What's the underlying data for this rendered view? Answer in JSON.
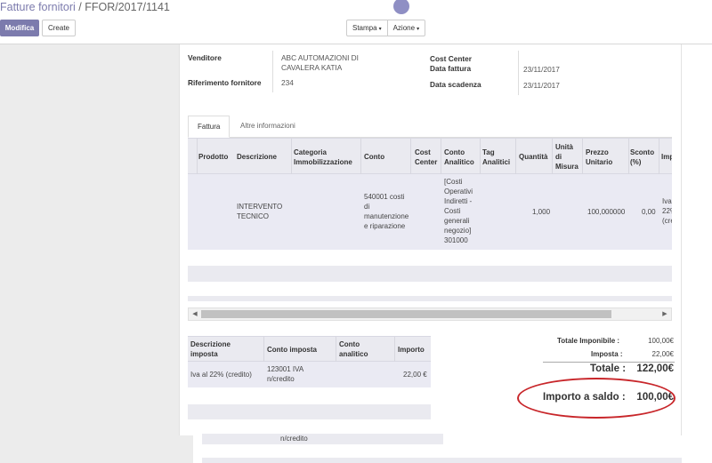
{
  "breadcrumb": {
    "parent": "Fatture fornitori",
    "separator": "/",
    "current": "FFOR/2017/1141"
  },
  "buttons": {
    "edit": "Modifica",
    "create": "Create",
    "print": "Stampa",
    "action": "Azione",
    "caret": "▾"
  },
  "header_fields": {
    "vendor_label": "Venditore",
    "vendor_value_line1": "ABC AUTOMAZIONI DI",
    "vendor_value_line2": "CAVALERA KATIA",
    "reference_label": "Riferimento fornitore",
    "reference_value": "234",
    "cost_center_label": "Cost Center",
    "invoice_date_label": "Data fattura",
    "invoice_date_value": "23/11/2017",
    "due_date_label": "Data scadenza",
    "due_date_value": "23/11/2017"
  },
  "tabs": [
    "Fattura",
    "Altre informazioni"
  ],
  "lines_table": {
    "headers": {
      "product": "Prodotto",
      "description": "Descrizione",
      "category_l1": "Categoria",
      "category_l2": "Immobilizzazione",
      "account": "Conto",
      "cost_center_l1": "Cost",
      "cost_center_l2": "Center",
      "analytic_l1": "Conto",
      "analytic_l2": "Analitico",
      "tags_l1": "Tag",
      "tags_l2": "Analitici",
      "quantity": "Quantità",
      "uom_l1": "Unità",
      "uom_l2": "di",
      "uom_l3": "Misura",
      "price_l1": "Prezzo",
      "price_l2": "Unitario",
      "discount_l1": "Sconto",
      "discount_l2": "(%)",
      "taxes": "Imp"
    },
    "row": {
      "description_l1": "INTERVENTO",
      "description_l2": "TECNICO",
      "account_l1": "540001 costi",
      "account_l2": "di",
      "account_l3": "manutenzione",
      "account_l4": "e riparazione",
      "analytic_l1": "[Costi",
      "analytic_l2": "Operativi",
      "analytic_l3": "Indiretti -",
      "analytic_l4": "Costi",
      "analytic_l5": "generali",
      "analytic_l6": "negozio]",
      "analytic_l7": "301000",
      "quantity": "1,000",
      "price": "100,000000",
      "discount": "0,00",
      "taxes_l1": "Iva",
      "taxes_l2": "22%",
      "taxes_l3": "(cre"
    }
  },
  "tax_table": {
    "headers": {
      "description_l1": "Descrizione",
      "description_l2": "imposta",
      "account": "Conto imposta",
      "analytic_l1": "Conto",
      "analytic_l2": "analitico",
      "amount": "Importo"
    },
    "row": {
      "description": "Iva al 22% (credito)",
      "account_l1": "123001 IVA",
      "account_l2": "n/credito",
      "amount": "22,00 €"
    },
    "overflow_text": "n/credito"
  },
  "totals": {
    "untaxed_label": "Totale Imponibile :",
    "untaxed_value": "100,00€",
    "tax_label": "Imposta :",
    "tax_value": "22,00€",
    "total_label": "Totale :",
    "total_value": "122,00€",
    "residual_label": "Importo a saldo :",
    "residual_value": "100,00€"
  },
  "colors": {
    "accent": "#7c7bad",
    "highlight_ellipse": "#c8262a"
  }
}
